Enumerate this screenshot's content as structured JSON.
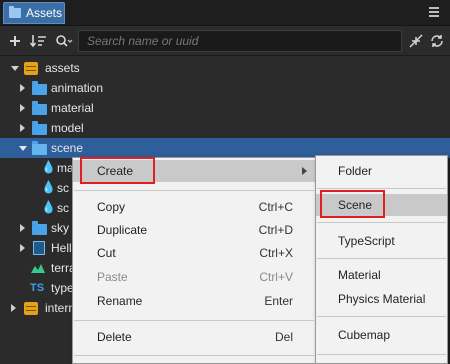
{
  "panel": {
    "tab_title": "Assets",
    "search_placeholder": "Search name or uuid"
  },
  "tree": {
    "items": [
      {
        "label": "assets",
        "icon": "database-icon",
        "expanded": true
      },
      {
        "label": "animation",
        "icon": "folder-icon"
      },
      {
        "label": "material",
        "icon": "folder-icon"
      },
      {
        "label": "model",
        "icon": "folder-icon"
      },
      {
        "label": "scene",
        "icon": "folder-open-icon",
        "selected": true
      },
      {
        "label": "ma",
        "icon": "scene-file-icon"
      },
      {
        "label": "sc",
        "icon": "scene-file-icon"
      },
      {
        "label": "sc",
        "icon": "scene-file-icon"
      },
      {
        "label": "sky",
        "icon": "folder-icon"
      },
      {
        "label": "Hell",
        "icon": "prefab-icon"
      },
      {
        "label": "terra",
        "icon": "terrain-icon"
      },
      {
        "label": "type",
        "icon": "typescript-icon"
      },
      {
        "label": "intern",
        "icon": "database-icon"
      }
    ],
    "ts_badge": "TS"
  },
  "context_menu": {
    "items": [
      {
        "label": "Create",
        "shortcut": "",
        "has_submenu": true,
        "highlighted": true
      },
      {
        "label": "Copy",
        "shortcut": "Ctrl+C"
      },
      {
        "label": "Duplicate",
        "shortcut": "Ctrl+D"
      },
      {
        "label": "Cut",
        "shortcut": "Ctrl+X"
      },
      {
        "label": "Paste",
        "shortcut": "Ctrl+V",
        "disabled": true
      },
      {
        "label": "Rename",
        "shortcut": "Enter"
      },
      {
        "label": "Delete",
        "shortcut": "Del"
      }
    ]
  },
  "submenu": {
    "items": [
      {
        "label": "Folder"
      },
      {
        "label": "Scene",
        "highlighted": true
      },
      {
        "label": "TypeScript"
      },
      {
        "label": "Material"
      },
      {
        "label": "Physics Material"
      },
      {
        "label": "Cubemap"
      }
    ]
  },
  "colors": {
    "selection": "#2f5f9a",
    "folder": "#4aa3e8",
    "highlight_box": "#e02020"
  }
}
